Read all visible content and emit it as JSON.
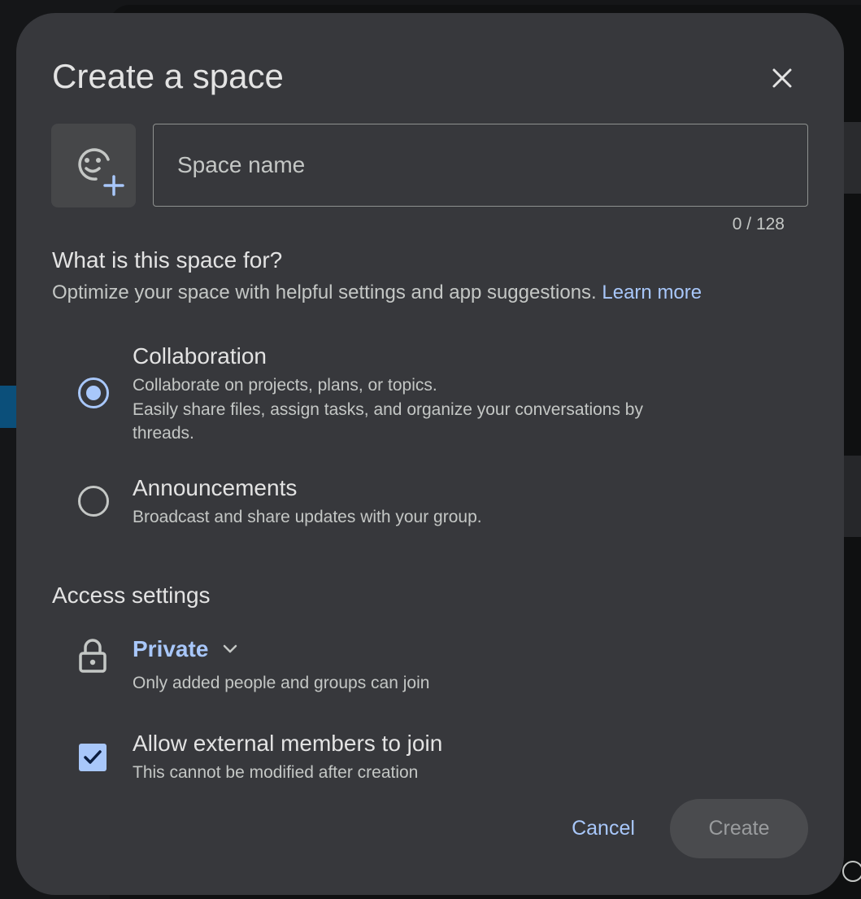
{
  "dialog": {
    "title": "Create a space",
    "close_icon": "close-icon",
    "emoji_icon": "add-emoji-icon"
  },
  "space_name": {
    "placeholder": "Space name",
    "value": "",
    "counter": "0 / 128"
  },
  "purpose": {
    "heading": "What is this space for?",
    "description": "Optimize your space with helpful settings and app suggestions.",
    "learn_more": "Learn more",
    "options": [
      {
        "title": "Collaboration",
        "lines": [
          "Collaborate on projects, plans, or topics.",
          "Easily share files, assign tasks, and organize your conversations by",
          "threads."
        ],
        "selected": true
      },
      {
        "title": "Announcements",
        "lines": [
          "Broadcast and share updates with your group."
        ],
        "selected": false
      }
    ]
  },
  "access": {
    "heading": "Access settings",
    "icon": "lock-icon",
    "selected": "Private",
    "description": "Only added people and groups can join"
  },
  "external": {
    "label": "Allow external members to join",
    "description": "This cannot be modified after creation",
    "checked": true
  },
  "actions": {
    "cancel": "Cancel",
    "create": "Create"
  },
  "colors": {
    "dialog_bg": "#37383c",
    "accent": "#a8c7fa",
    "text_primary": "#e3e3e3",
    "text_secondary": "#c4c7c5"
  }
}
